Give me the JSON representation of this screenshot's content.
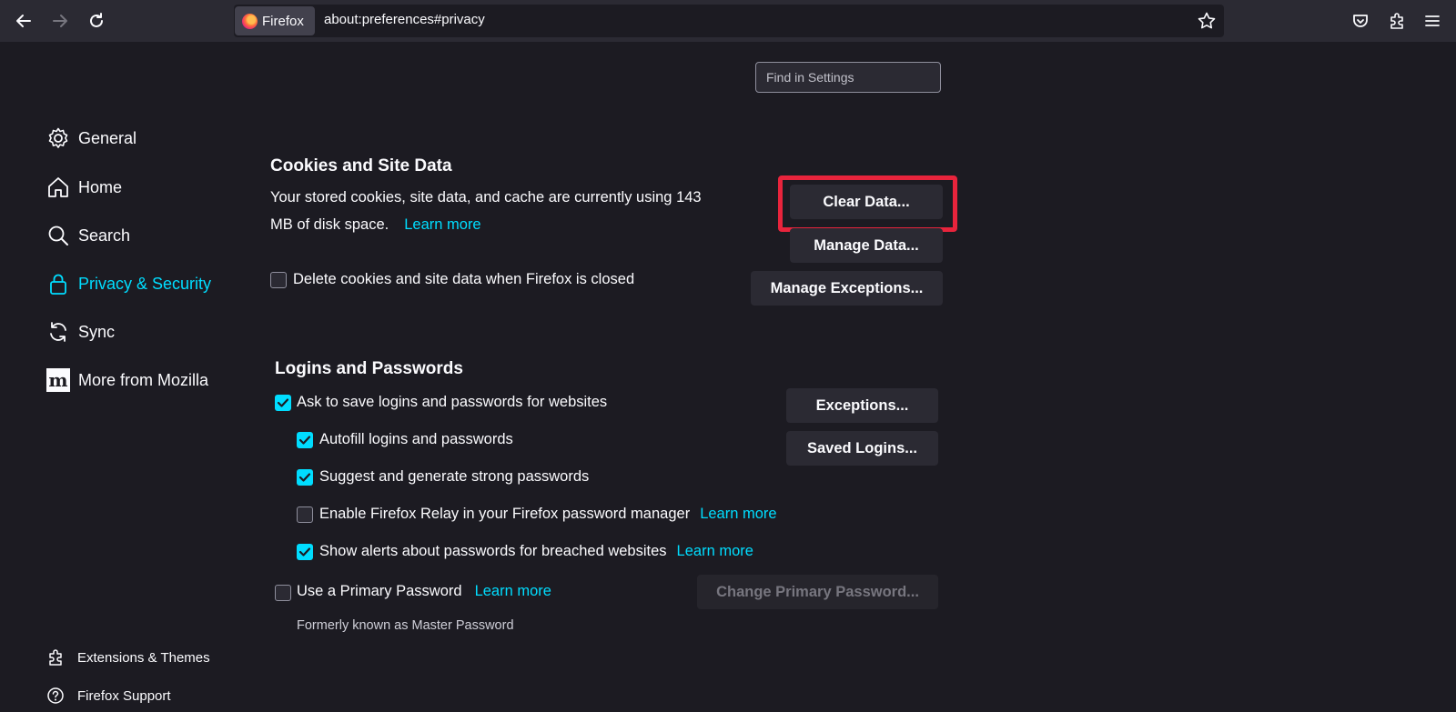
{
  "toolbar": {
    "identity_label": "Firefox",
    "url": "about:preferences#privacy"
  },
  "search": {
    "placeholder": "Find in Settings"
  },
  "sidebar": {
    "categories": [
      {
        "label": "General",
        "icon": "gear-icon"
      },
      {
        "label": "Home",
        "icon": "home-icon"
      },
      {
        "label": "Search",
        "icon": "search-icon"
      },
      {
        "label": "Privacy & Security",
        "icon": "lock-icon",
        "selected": true
      },
      {
        "label": "Sync",
        "icon": "sync-icon"
      },
      {
        "label": "More from Mozilla",
        "icon": "mozilla-icon"
      }
    ],
    "footer": [
      {
        "label": "Extensions & Themes",
        "icon": "extension-icon"
      },
      {
        "label": "Firefox Support",
        "icon": "help-icon"
      }
    ]
  },
  "cookies": {
    "heading": "Cookies and Site Data",
    "desc_line1": "Your stored cookies, site data, and cache are currently using 143",
    "desc_line2": "MB of disk space.",
    "learn_more": "Learn more",
    "clear_data": "Clear Data...",
    "manage_data": "Manage Data...",
    "manage_exceptions": "Manage Exceptions...",
    "delete_on_close": {
      "label": "Delete cookies and site data when Firefox is closed",
      "checked": false
    }
  },
  "logins": {
    "heading": "Logins and Passwords",
    "ask_to_save": {
      "label": "Ask to save logins and passwords for websites",
      "checked": true
    },
    "autofill": {
      "label": "Autofill logins and passwords",
      "checked": true
    },
    "suggest": {
      "label": "Suggest and generate strong passwords",
      "checked": true
    },
    "relay": {
      "label": "Enable Firefox Relay in your Firefox password manager",
      "checked": false,
      "learn_more": "Learn more"
    },
    "breach_alerts": {
      "label": "Show alerts about passwords for breached websites",
      "checked": true,
      "learn_more": "Learn more"
    },
    "primary_password": {
      "label": "Use a Primary Password",
      "checked": false,
      "learn_more": "Learn more"
    },
    "formerly": "Formerly known as Master Password",
    "exceptions": "Exceptions...",
    "saved_logins": "Saved Logins...",
    "change_primary": "Change Primary Password..."
  },
  "colors": {
    "accent": "#00ddff",
    "highlight": "#e8243c",
    "background": "#1c1b22"
  }
}
